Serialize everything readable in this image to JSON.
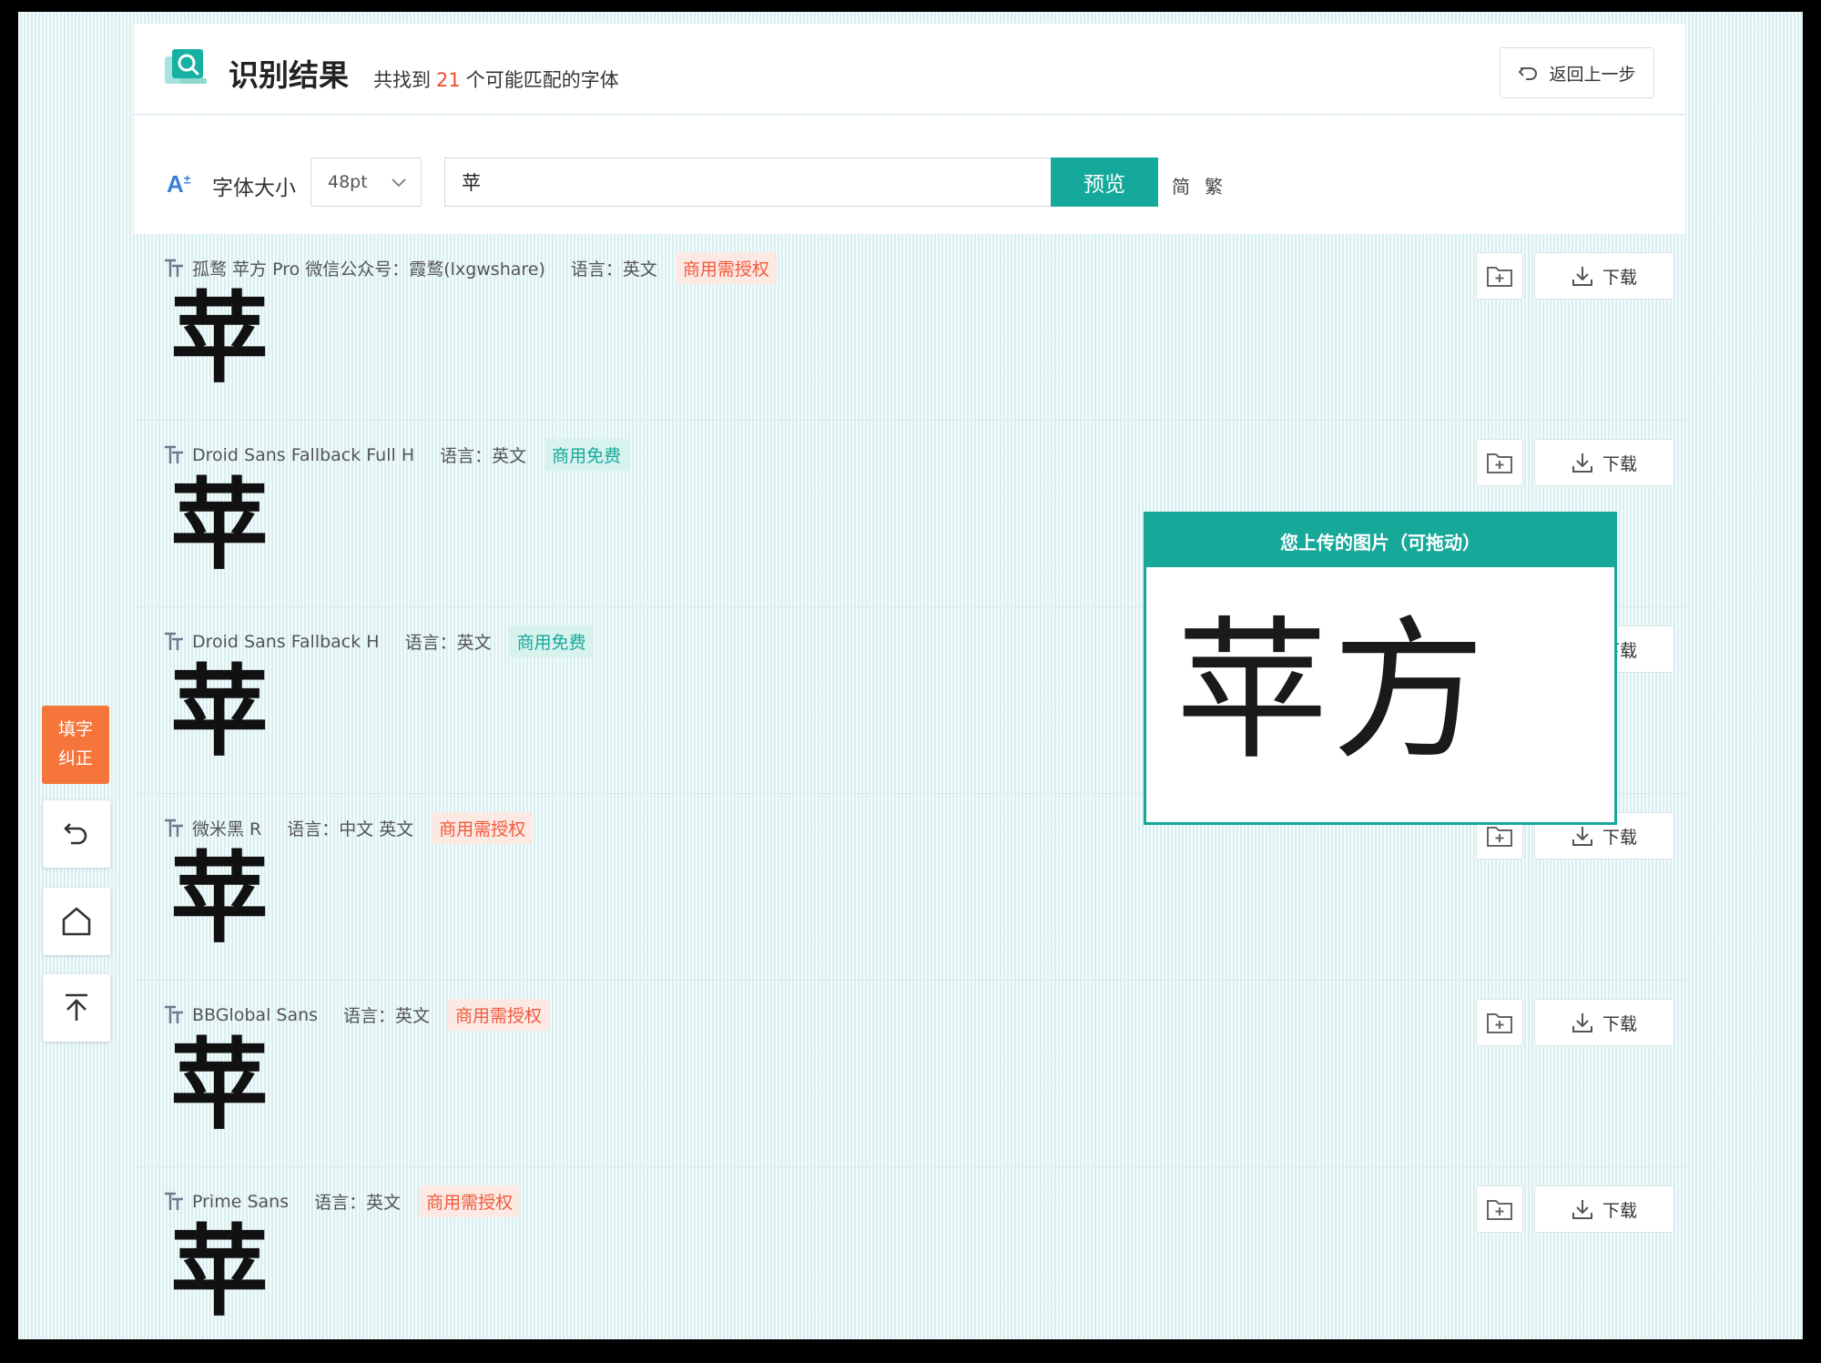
{
  "header": {
    "title": "识别结果",
    "found_prefix": "共找到",
    "found_count": "21",
    "found_suffix": "个可能匹配的字体",
    "back_label": "返回上一步"
  },
  "toolbar": {
    "size_label": "字体大小",
    "size_value": "48pt",
    "input_value": "苹",
    "preview_label": "预览",
    "simplified_label": "简",
    "traditional_label": "繁"
  },
  "colors": {
    "accent": "#15a99c",
    "badge_paid": "#f05a3c",
    "correct_button": "#f5753a"
  },
  "fonts": [
    {
      "name": "孤鹜 苹方 Pro 微信公众号：霞鹜(lxgwshare)",
      "language": "语言：英文",
      "license": "商用需授权",
      "license_type": "paid",
      "sample": "苹",
      "download_label": "下载"
    },
    {
      "name": "Droid Sans Fallback Full H",
      "language": "语言：英文",
      "license": "商用免费",
      "license_type": "free",
      "sample": "苹",
      "download_label": "下载"
    },
    {
      "name": "Droid Sans Fallback H",
      "language": "语言：英文",
      "license": "商用免费",
      "license_type": "free",
      "sample": "苹",
      "download_label": "下载"
    },
    {
      "name": "微米黑 R",
      "language": "语言：中文 英文",
      "license": "商用需授权",
      "license_type": "paid",
      "sample": "苹",
      "download_label": "下载"
    },
    {
      "name": "BBGlobal Sans",
      "language": "语言：英文",
      "license": "商用需授权",
      "license_type": "paid",
      "sample": "苹",
      "download_label": "下载"
    },
    {
      "name": "Prime Sans",
      "language": "语言：英文",
      "license": "商用需授权",
      "license_type": "paid",
      "sample": "苹",
      "download_label": "下载"
    }
  ],
  "side": {
    "correct_line1": "填字",
    "correct_line2": "纠正"
  },
  "upload_panel": {
    "title": "您上传的图片（可拖动）",
    "glyphs": "苹方"
  }
}
